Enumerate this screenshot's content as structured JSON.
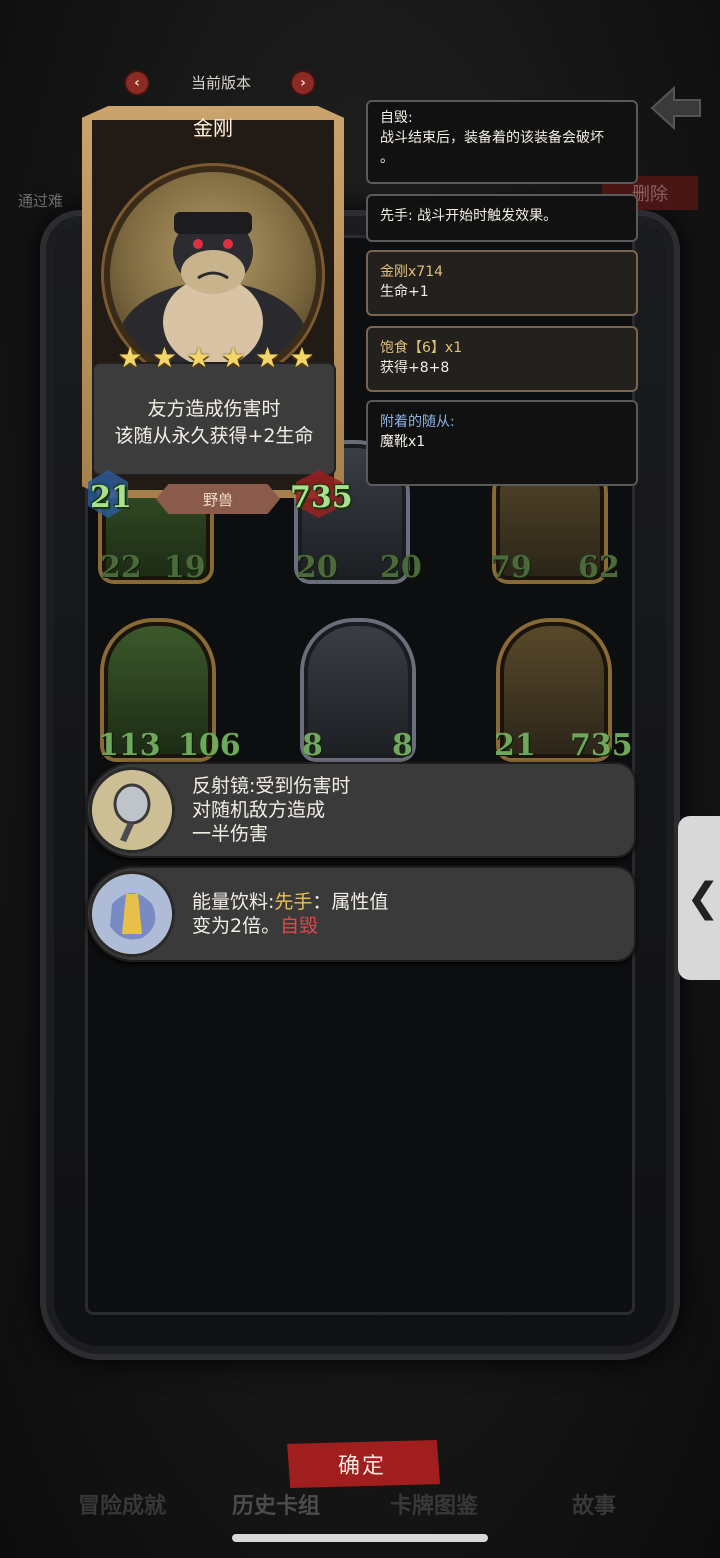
{
  "header": {
    "version_label": "当前版本",
    "prev_icon": "‹",
    "next_icon": "›",
    "pass_text": "通过难",
    "delete_label": "删除"
  },
  "card": {
    "name": "金刚",
    "stars": [
      "★",
      "★",
      "★",
      "★",
      "★",
      "★"
    ],
    "desc_line1": "友方造成伤害时",
    "desc_line2": "该随从永久获得+2生命",
    "attack": "21",
    "health": "735",
    "tribe": "野兽"
  },
  "panels": [
    {
      "title": "自毁:",
      "body": "战斗结束后，装备着的该装备会破坏",
      "extra": "。"
    },
    {
      "title": "先手: 战斗开始时触发效果。"
    },
    {
      "line1": "金刚x714",
      "line2": "生命+1"
    },
    {
      "line1": "饱食【6】x1",
      "line2": "获得+8+8"
    },
    {
      "line1": "附着的随从:",
      "line2": "魔靴x1"
    }
  ],
  "board_row1": [
    {
      "atk": "22",
      "hp": "19"
    },
    {
      "atk": "20",
      "hp": "20"
    },
    {
      "atk": "79",
      "hp": "62"
    }
  ],
  "board_row2": [
    {
      "atk": "113",
      "hp": "106"
    },
    {
      "atk": "8",
      "hp": "8"
    },
    {
      "atk": "21",
      "hp": "735"
    }
  ],
  "equipment": [
    {
      "line1": "反射镜:受到伤害时",
      "line2": "对随机敌方造成",
      "line3": "一半伤害"
    },
    {
      "prefix": "能量饮料:",
      "kw1": "先手",
      "mid": "：属性值",
      "line2a": "变为2倍。",
      "kw2": "自毁"
    }
  ],
  "side_tab_icon": "❮",
  "confirm_label": "确定",
  "nav": [
    "冒险成就",
    "历史卡组",
    "卡牌图鉴",
    "故事"
  ],
  "colors": {
    "accent_red": "#a01e1e",
    "star": "#f2d66a",
    "stat_green": "#a8e08c"
  }
}
